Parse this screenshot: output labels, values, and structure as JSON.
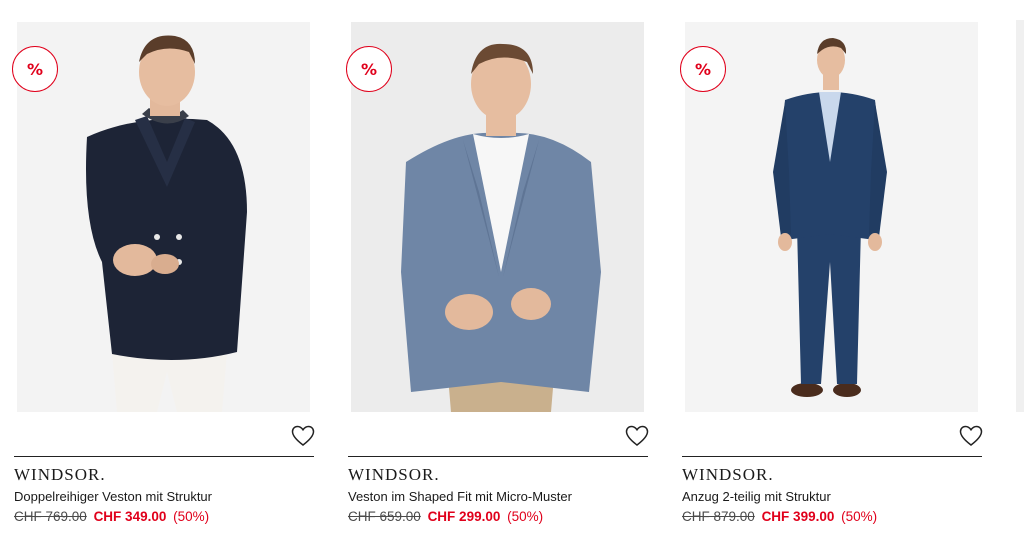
{
  "products": [
    {
      "badge": "%",
      "brand": "WINDSOR.",
      "name": "Doppelreihiger Veston mit Struktur",
      "old_price": "CHF 769.00",
      "new_price": "CHF 349.00",
      "discount": "(50%)",
      "icons": {
        "wishlist": "heart-outline-icon"
      },
      "colors": {
        "jacket": "#1d2436",
        "pants": "#f4f2ee",
        "background": "#f3f3f3"
      }
    },
    {
      "badge": "%",
      "brand": "WINDSOR.",
      "name": "Veston im Shaped Fit mit Micro-Muster",
      "old_price": "CHF 659.00",
      "new_price": "CHF 299.00",
      "discount": "(50%)",
      "icons": {
        "wishlist": "heart-outline-icon"
      },
      "colors": {
        "jacket": "#6f86a6",
        "pants": "#c9b08d",
        "background": "#ececec"
      }
    },
    {
      "badge": "%",
      "brand": "WINDSOR.",
      "name": "Anzug 2-teilig mit Struktur",
      "old_price": "CHF 879.00",
      "new_price": "CHF 399.00",
      "discount": "(50%)",
      "icons": {
        "wishlist": "heart-outline-icon"
      },
      "colors": {
        "suit": "#24416a",
        "shoes": "#4a2c1d",
        "background": "#f4f4f4"
      }
    }
  ],
  "theme": {
    "sale_red": "#e0001b",
    "text": "#1a1a1a"
  }
}
